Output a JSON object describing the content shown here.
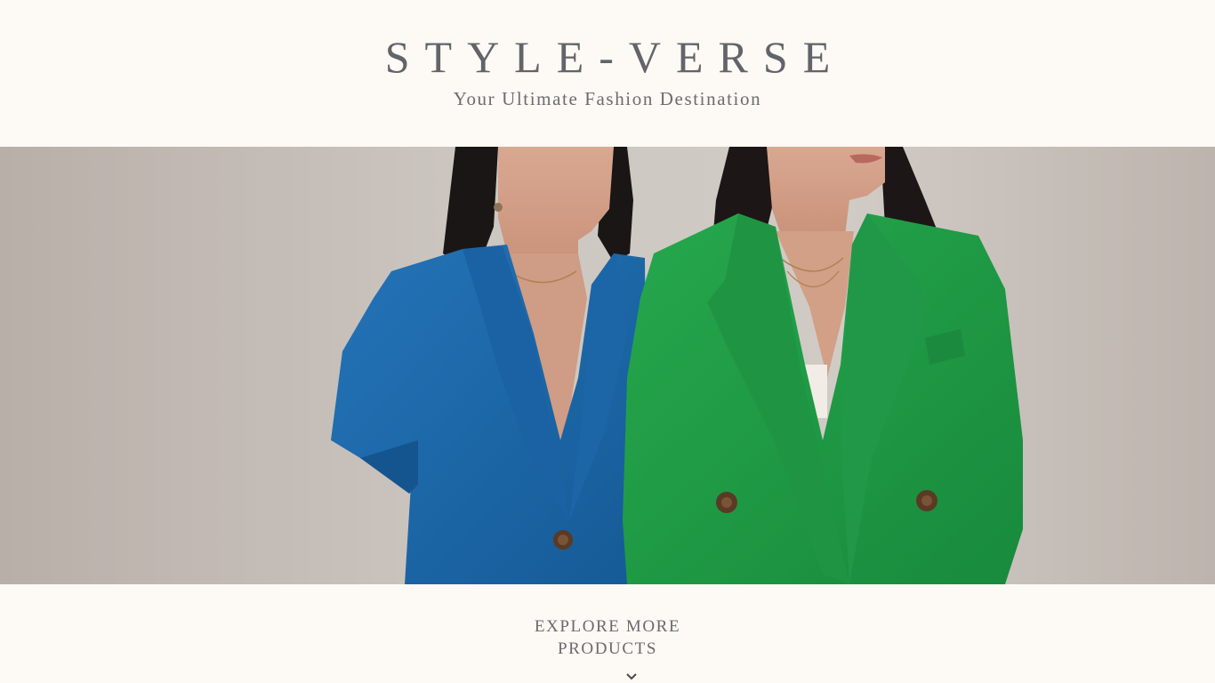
{
  "header": {
    "title": "STYLE-VERSE",
    "tagline": "Your Ultimate Fashion Destination"
  },
  "hero": {
    "image_icon": "hero-fashion-photo"
  },
  "explore": {
    "label_line1": "EXPLORE MORE",
    "label_line2": "PRODUCTS",
    "icon": "chevron-down-icon"
  },
  "colors": {
    "background": "#fdf9f4",
    "text": "#616469",
    "blue_blazer": "#1f6aaa",
    "green_blazer": "#1f9a45"
  }
}
